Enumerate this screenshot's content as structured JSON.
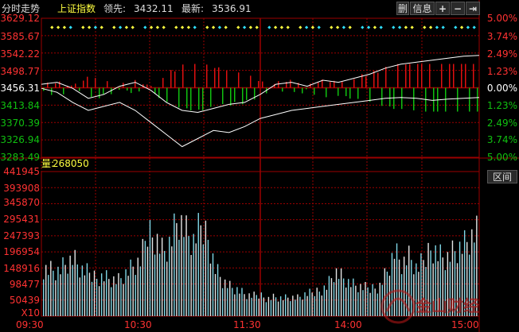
{
  "header": {
    "mode_label": "分时走势",
    "index_name": "上证指数",
    "lead_label": "领先:",
    "lead_value": "3432.11",
    "latest_label": "最新:",
    "latest_value": "3536.91"
  },
  "toolbar": {
    "buttons": [
      {
        "label": "删",
        "icon": "delete-icon"
      },
      {
        "label": "信息",
        "icon": "info-icon"
      },
      {
        "label": "+",
        "icon": "plus-icon"
      },
      {
        "label": "−",
        "icon": "minus-icon"
      },
      {
        "label": "⇥",
        "icon": "exit-icon"
      }
    ]
  },
  "price_axis_left": [
    "3629.12",
    "3585.67",
    "3542.22",
    "3498.77",
    "3456.31",
    "3413.84",
    "3370.39",
    "3326.94",
    "3283.49"
  ],
  "price_axis_right": [
    "5.00%",
    "3.74%",
    "2.49%",
    "1.23%",
    "0.00%",
    "1.23%",
    "2.49%",
    "3.74%",
    "5.00%"
  ],
  "volume": {
    "label": "量:",
    "value": "268050",
    "axis": [
      "441945",
      "393908",
      "345870",
      "295431",
      "247393",
      "196954",
      "148916",
      "98477",
      "50439"
    ],
    "unit": "X10",
    "corner_button": "区间"
  },
  "time_axis": [
    "09:30",
    "10:30",
    "11:30",
    "14:00",
    "15:00"
  ],
  "watermark": "金山财经",
  "colors": {
    "background": "#000000",
    "grid": "#9c0000",
    "axis_text": "#ff3232",
    "up": "#e01010",
    "down": "#10c010",
    "price_line": "#ffffff",
    "volume_bar": "#7fd7e6",
    "volume_alt": "#e6e6e6",
    "highlight": "#ffff40"
  },
  "chart_data": {
    "type": "line",
    "title": "",
    "xlabel": "",
    "ylabel": "",
    "x": [
      "09:30",
      "10:30",
      "11:30",
      "14:00",
      "15:00"
    ],
    "ylim": [
      3283.49,
      3629.12
    ],
    "prev_close": 3456.31,
    "series": [
      {
        "values": [
          3465,
          3470,
          3455,
          3430,
          3440,
          3460,
          3470,
          3450,
          3420,
          3400,
          3395,
          3405,
          3415,
          3420,
          3440,
          3465,
          3470,
          3460,
          3475,
          3470,
          3480,
          3490,
          3505,
          3515,
          3520,
          3525,
          3530,
          3535,
          3536.91
        ]
      },
      {
        "values": [
          3455,
          3445,
          3420,
          3400,
          3410,
          3420,
          3400,
          3370,
          3340,
          3310,
          3330,
          3350,
          3345,
          3360,
          3380,
          3390,
          3400,
          3405,
          3410,
          3415,
          3420,
          3425,
          3430,
          3432,
          3430,
          3425,
          3428,
          3430,
          3432.11
        ]
      }
    ],
    "volume_series": {
      "ylim": [
        0,
        441945
      ],
      "values": [
        150000,
        145000,
        140000,
        160000,
        175000,
        140000,
        130000,
        120000,
        125000,
        115000,
        110000,
        130000,
        150000,
        165000,
        260000,
        250000,
        200000,
        230000,
        300000,
        260000,
        220000,
        270000,
        250000,
        150000,
        110000,
        90000,
        80000,
        65000,
        60000,
        65000,
        55000,
        60000,
        55000,
        58000,
        55000,
        65000,
        70000,
        80000,
        95000,
        140000,
        120000,
        100000,
        90000,
        85000,
        85000,
        95000,
        140000,
        200000,
        160000,
        180000,
        140000,
        170000,
        220000,
        190000,
        180000,
        200000,
        210000,
        230000,
        250000
      ]
    }
  }
}
